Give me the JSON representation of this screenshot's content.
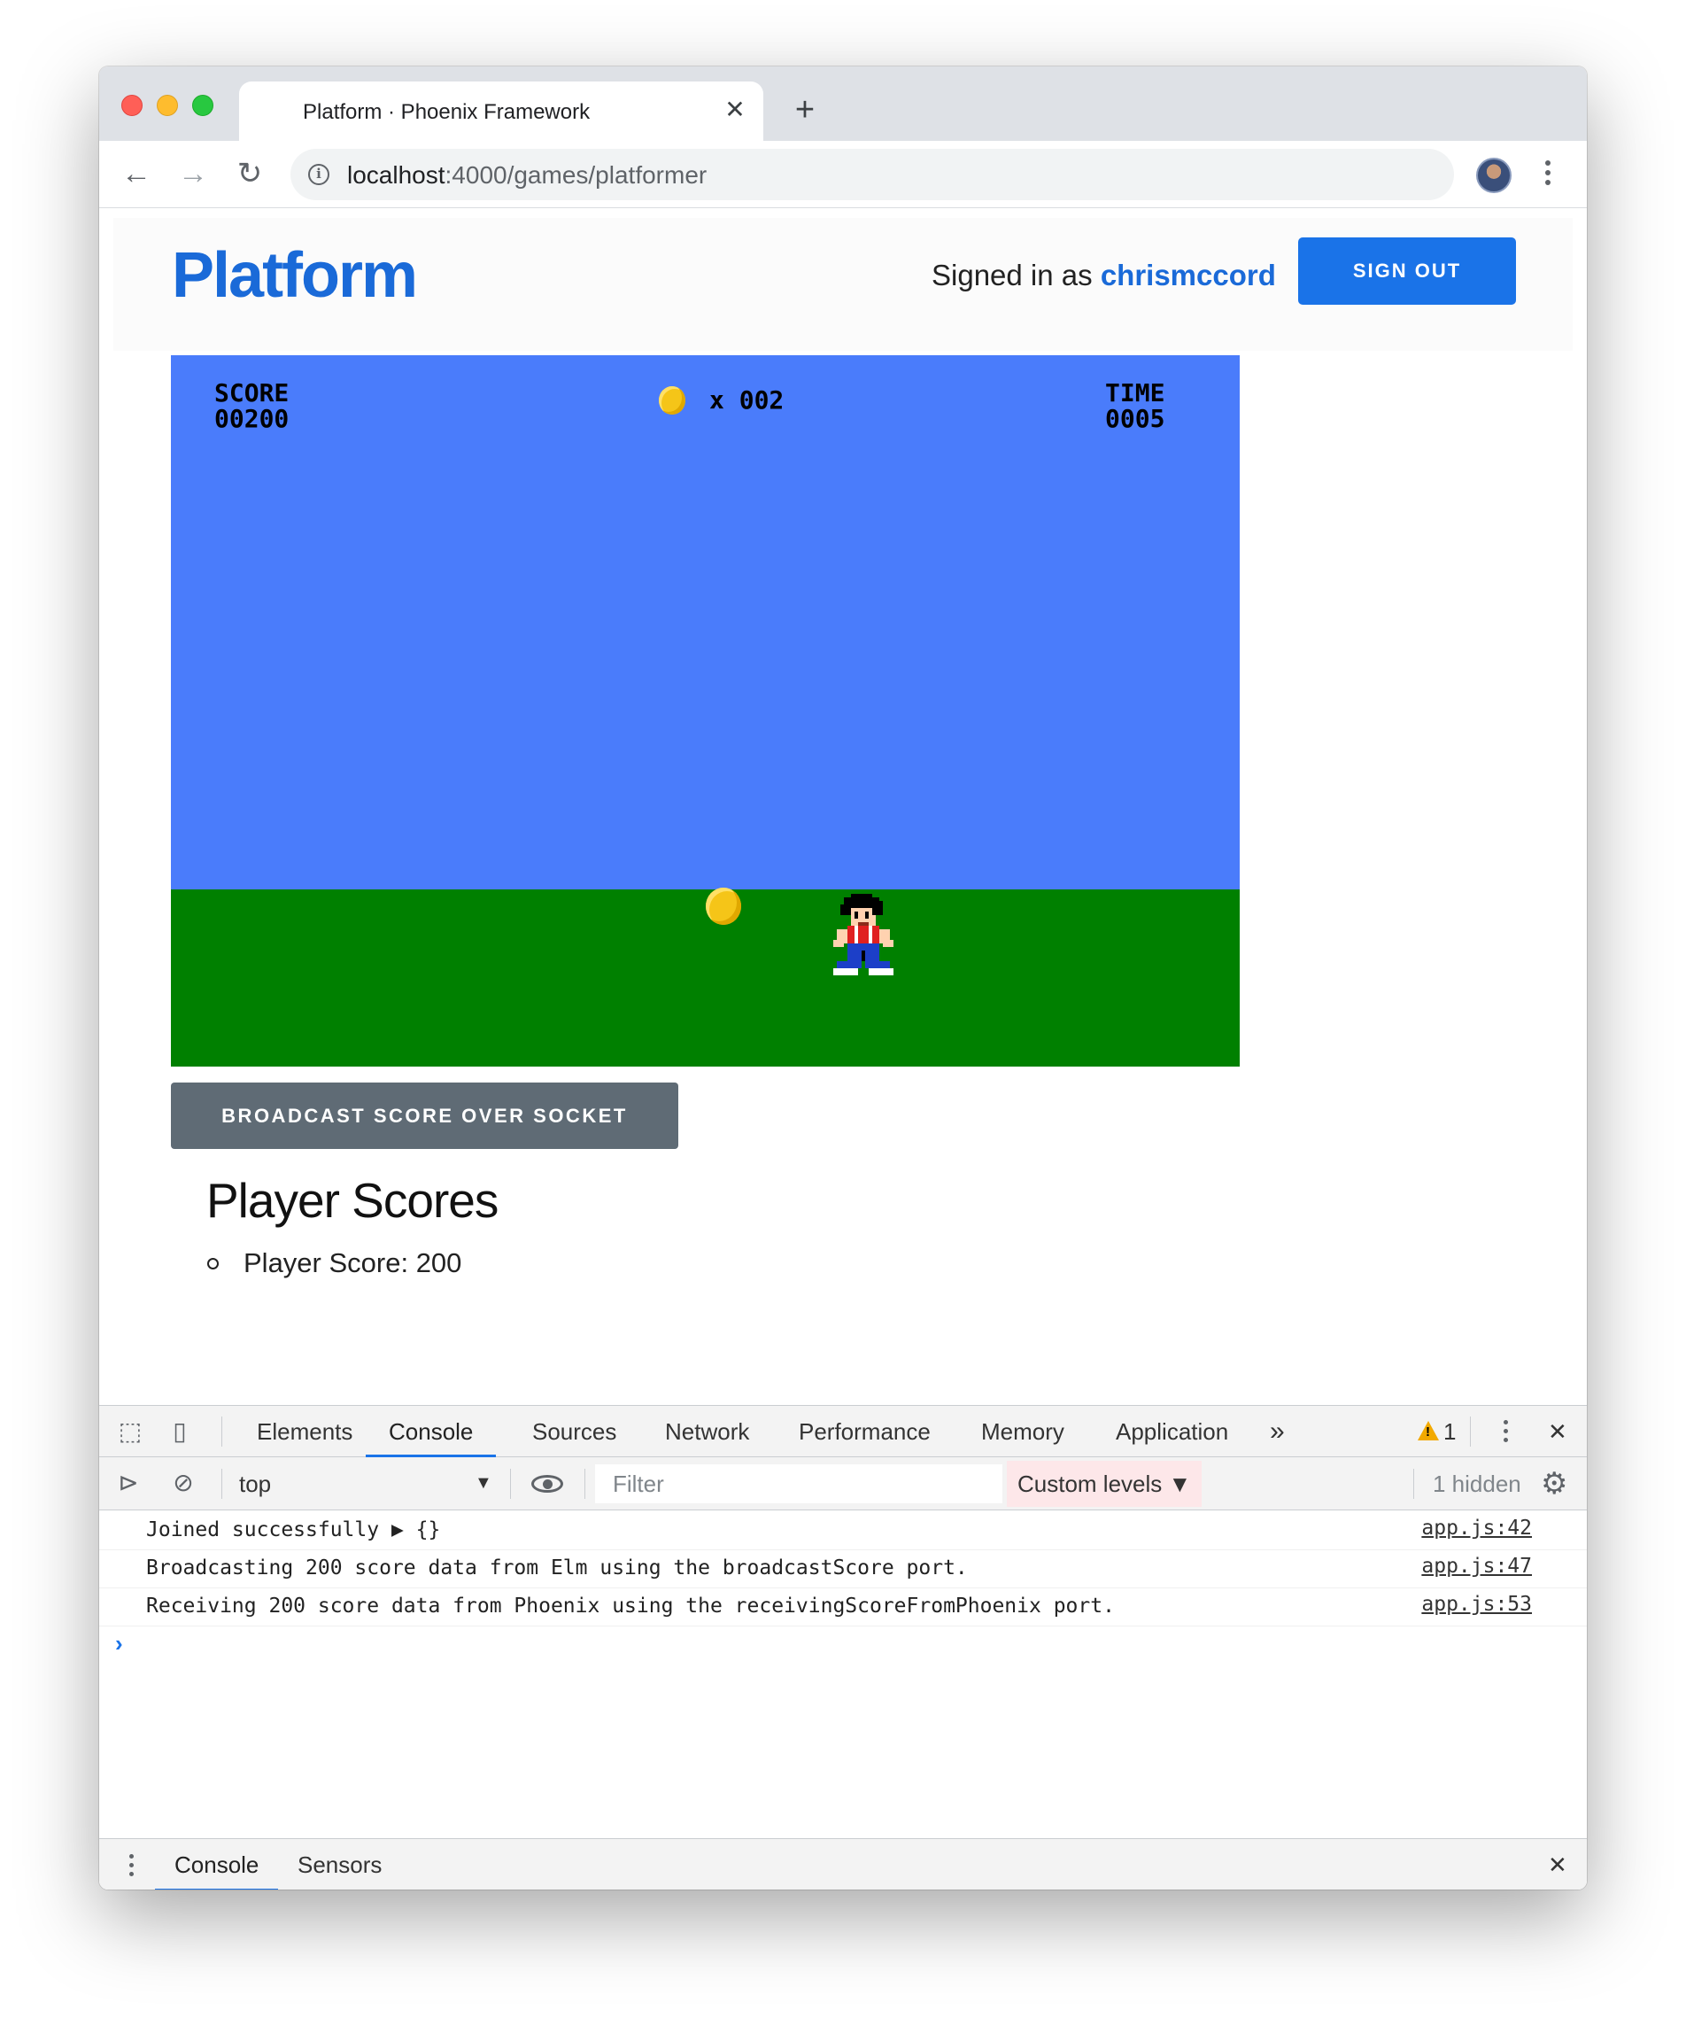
{
  "browser": {
    "tab_title": "Platform · Phoenix Framework",
    "tab_close": "✕",
    "new_tab": "+",
    "url_host": "localhost",
    "url_path": ":4000/games/platformer"
  },
  "site": {
    "logo": "Platform",
    "signed_in_prefix": "Signed in as ",
    "username": "chrismccord",
    "sign_out_label": "SIGN OUT"
  },
  "game": {
    "score_label": "SCORE",
    "score_value": "00200",
    "coins_text": "x 002",
    "time_label": "TIME",
    "time_value": "0005",
    "sky_color": "#4a7cfb",
    "ground_color": "#008000"
  },
  "broadcast_label": "BROADCAST SCORE OVER SOCKET",
  "scores": {
    "title": "Player Scores",
    "items": [
      "Player Score: 200"
    ]
  },
  "devtools": {
    "tabs": [
      "Elements",
      "Console",
      "Sources",
      "Network",
      "Performance",
      "Memory",
      "Application"
    ],
    "active_tab": "Console",
    "more": "»",
    "warning_count": "1",
    "context": "top",
    "filter_placeholder": "Filter",
    "levels": "Custom levels ▼",
    "hidden": "1 hidden",
    "messages": [
      {
        "text": "Joined successfully ▶ {}",
        "source": "app.js:42"
      },
      {
        "text": "Broadcasting 200 score data from Elm using the broadcastScore port.",
        "source": "app.js:47"
      },
      {
        "text": "Receiving 200 score data from Phoenix using the receivingScoreFromPhoenix port.",
        "source": "app.js:53"
      }
    ],
    "prompt": "›",
    "drawer_tabs": [
      "Console",
      "Sensors"
    ],
    "close": "✕"
  }
}
